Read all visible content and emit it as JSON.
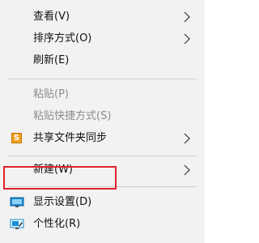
{
  "context_menu": {
    "items": [
      {
        "label": "查看(V)",
        "has_submenu": true,
        "enabled": true
      },
      {
        "label": "排序方式(O)",
        "has_submenu": true,
        "enabled": true
      },
      {
        "label": "刷新(E)",
        "has_submenu": false,
        "enabled": true
      },
      {
        "label": "粘贴(P)",
        "has_submenu": false,
        "enabled": false
      },
      {
        "label": "粘贴快捷方式(S)",
        "has_submenu": false,
        "enabled": false
      },
      {
        "label": "共享文件夹同步",
        "icon": "sync-share-s-icon",
        "icon_text": "S",
        "has_submenu": true,
        "enabled": true
      },
      {
        "label": "新建(W)",
        "has_submenu": true,
        "enabled": true
      },
      {
        "label": "显示设置(D)",
        "icon": "display-settings-icon",
        "has_submenu": false,
        "enabled": true,
        "highlighted": true
      },
      {
        "label": "个性化(R)",
        "icon": "personalize-icon",
        "has_submenu": false,
        "enabled": true
      }
    ]
  },
  "colors": {
    "menu_background": "#f2f2f2",
    "separator": "#cfcfcf",
    "disabled_text": "#8c8c8c",
    "highlight_box": "#e2212b",
    "display_icon_blue": "#1a8fd6",
    "s_icon_orange": "#f0a020"
  }
}
